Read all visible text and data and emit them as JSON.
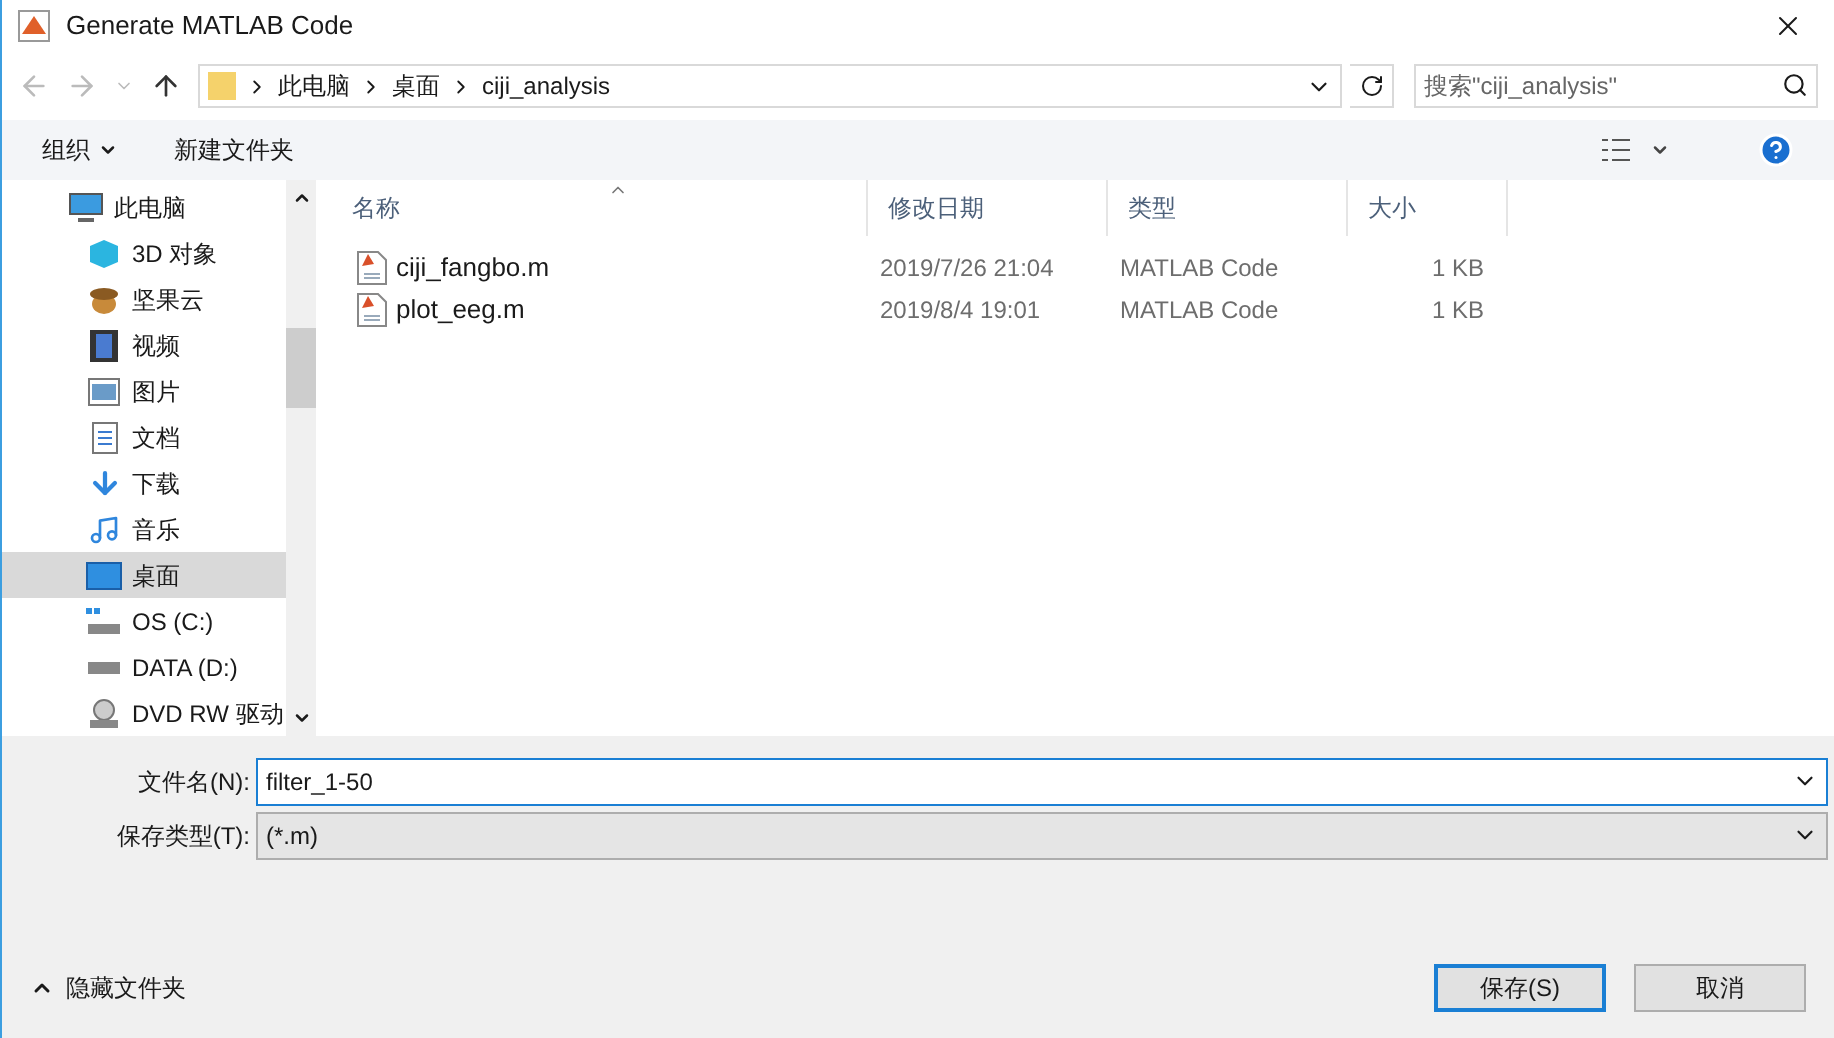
{
  "window": {
    "title": "Generate MATLAB Code"
  },
  "address": {
    "path": [
      "此电脑",
      "桌面",
      "ciji_analysis"
    ]
  },
  "search": {
    "placeholder": "搜索\"ciji_analysis\""
  },
  "toolbar": {
    "organize": "组织",
    "new_folder": "新建文件夹"
  },
  "sidebar": {
    "items": [
      {
        "label": "此电脑",
        "kind": "pc",
        "selected": false,
        "children": [
          {
            "label": "3D 对象",
            "kind": "cube",
            "selected": false
          },
          {
            "label": "坚果云",
            "kind": "nut",
            "selected": false
          },
          {
            "label": "视频",
            "kind": "film",
            "selected": false
          },
          {
            "label": "图片",
            "kind": "picture",
            "selected": false
          },
          {
            "label": "文档",
            "kind": "doc",
            "selected": false
          },
          {
            "label": "下载",
            "kind": "download",
            "selected": false
          },
          {
            "label": "音乐",
            "kind": "music",
            "selected": false
          },
          {
            "label": "桌面",
            "kind": "desktop",
            "selected": true
          },
          {
            "label": "OS (C:)",
            "kind": "osdrive",
            "selected": false
          },
          {
            "label": "DATA (D:)",
            "kind": "drive",
            "selected": false
          },
          {
            "label": "DVD RW 驱动",
            "kind": "dvd",
            "selected": false
          }
        ]
      }
    ]
  },
  "table": {
    "columns": [
      "名称",
      "修改日期",
      "类型",
      "大小"
    ],
    "rows": [
      {
        "name": "ciji_fangbo.m",
        "date": "2019/7/26 21:04",
        "type": "MATLAB Code",
        "size": "1 KB"
      },
      {
        "name": "plot_eeg.m",
        "date": "2019/8/4 19:01",
        "type": "MATLAB Code",
        "size": "1 KB"
      }
    ]
  },
  "form": {
    "filename_label": "文件名(N):",
    "filename": "filter_1-50",
    "type_label": "保存类型(T):",
    "type": "(*.m)"
  },
  "hide_folders": "隐藏文件夹",
  "buttons": {
    "save": "保存(S)",
    "cancel": "取消"
  }
}
